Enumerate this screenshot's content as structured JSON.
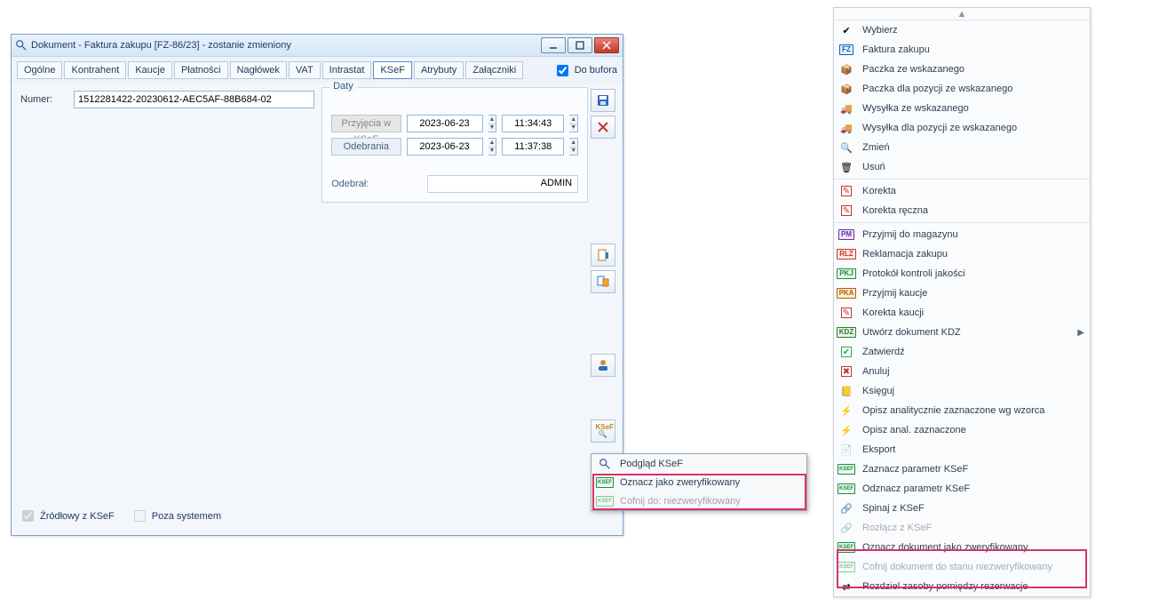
{
  "window": {
    "title": "Dokument - Faktura zakupu [FZ-86/23]  - zostanie zmieniony",
    "tabs": [
      "Ogólne",
      "Kontrahent",
      "Kaucje",
      "Płatności",
      "Nagłówek",
      "VAT",
      "Intrastat",
      "KSeF",
      "Atrybuty",
      "Załączniki"
    ],
    "active_tab_index": 7,
    "do_bufora": {
      "label": "Do bufora",
      "checked": true
    },
    "numer_label": "Numer:",
    "numer_value": "1512281422-20230612-AEC5AF-88B684-02",
    "daty": {
      "legend": "Daty",
      "rows": [
        {
          "label": "Przyjęcia w KSeF",
          "date": "2023-06-23",
          "time": "11:34:43"
        },
        {
          "label": "Odebrania",
          "date": "2023-06-23",
          "time": "11:37:38"
        }
      ],
      "odebral_label": "Odebrał:",
      "odebral_value": "ADMIN"
    },
    "footer": {
      "zrodlowy": {
        "label": "Źródłowy z KSeF",
        "checked": true
      },
      "poza": {
        "label": "Poza systemem",
        "checked": false
      }
    }
  },
  "popup": {
    "items": [
      {
        "label": "Podgląd KSeF",
        "disabled": false
      },
      {
        "label": "Oznacz jako zweryfikowany",
        "disabled": false
      },
      {
        "label": "Cofnij do: niezweryfikowany",
        "disabled": true
      }
    ]
  },
  "ctx": {
    "items": [
      {
        "label": "Wybierz"
      },
      {
        "label": "Faktura zakupu"
      },
      {
        "label": "Paczka ze wskazanego"
      },
      {
        "label": "Paczka dla pozycji ze wskazanego"
      },
      {
        "label": "Wysyłka ze wskazanego"
      },
      {
        "label": "Wysyłka dla pozycji ze wskazanego"
      },
      {
        "label": "Zmień"
      },
      {
        "label": "Usuń"
      },
      {
        "sep": true
      },
      {
        "label": "Korekta"
      },
      {
        "label": "Korekta ręczna"
      },
      {
        "sep": true
      },
      {
        "label": "Przyjmij do magazynu"
      },
      {
        "label": "Reklamacja zakupu"
      },
      {
        "label": "Protokół kontroli jakości"
      },
      {
        "label": "Przyjmij kaucje"
      },
      {
        "label": "Korekta kaucji"
      },
      {
        "label": "Utwórz dokument KDZ",
        "submenu": true
      },
      {
        "label": "Zatwierdź"
      },
      {
        "label": "Anuluj"
      },
      {
        "label": "Księguj"
      },
      {
        "label": "Opisz analitycznie zaznaczone wg wzorca"
      },
      {
        "label": "Opisz anal. zaznaczone"
      },
      {
        "label": "Eksport"
      },
      {
        "label": "Zaznacz parametr KSeF"
      },
      {
        "label": "Odznacz parametr KSeF"
      },
      {
        "label": "Spinaj z KSeF"
      },
      {
        "label": "Rozłącz z KSeF",
        "disabled": true
      },
      {
        "label": "Oznacz dokument jako zweryfikowany"
      },
      {
        "label": "Cofnij dokument do stanu niezweryfikowany",
        "disabled": true
      },
      {
        "label": "Rozdziel zasoby pomiędzy rezerwacje"
      }
    ]
  }
}
